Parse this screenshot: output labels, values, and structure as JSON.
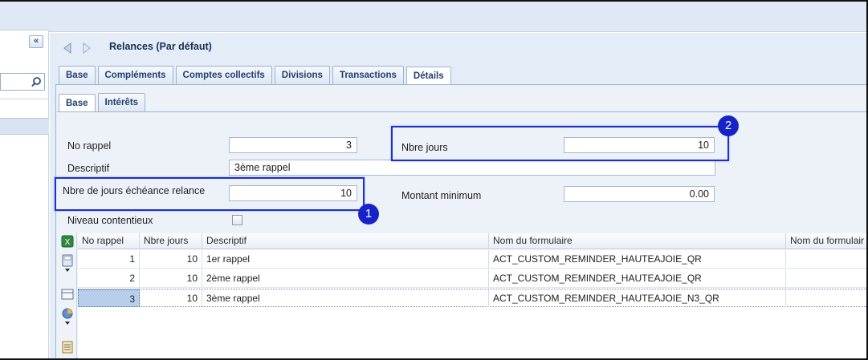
{
  "page": {
    "title": "Relances (Par défaut)"
  },
  "tabs": [
    "Base",
    "Compléments",
    "Comptes collectifs",
    "Divisions",
    "Transactions",
    "Détails"
  ],
  "active_tab": "Détails",
  "subtabs": [
    "Base",
    "Intérêts"
  ],
  "active_subtab": "Base",
  "form": {
    "no_rappel_label": "No rappel",
    "no_rappel_value": "3",
    "descriptif_label": "Descriptif",
    "descriptif_value": "3ème rappel",
    "nbre_jours_echeance_label": "Nbre de jours échéance relance",
    "nbre_jours_echeance_value": "10",
    "niveau_contentieux_label": "Niveau contentieux",
    "nbre_jours_label": "Nbre jours",
    "nbre_jours_value": "10",
    "montant_minimum_label": "Montant minimum",
    "montant_minimum_value": "0.00"
  },
  "callouts": [
    "1",
    "2"
  ],
  "grid": {
    "columns": [
      "No rappel",
      "Nbre jours",
      "Descriptif",
      "Nom du formulaire",
      "Nom du formulair"
    ],
    "rows": [
      {
        "no": "1",
        "jours": "10",
        "descriptif": "1er rappel",
        "formulaire": "ACT_CUSTOM_REMINDER_HAUTEAJOIE_QR"
      },
      {
        "no": "2",
        "jours": "10",
        "descriptif": "2ème rappel",
        "formulaire": "ACT_CUSTOM_REMINDER_HAUTEAJOIE_QR"
      },
      {
        "no": "3",
        "jours": "10",
        "descriptif": "3ème rappel",
        "formulaire": "ACT_CUSTOM_REMINDER_HAUTEAJOIE_N3_QR"
      }
    ]
  },
  "left": {
    "collapse_label": "«"
  },
  "colors": {
    "accent": "#1c2fd0",
    "badge": "#1523c8",
    "panel": "#edf2f9",
    "header_text": "#22406c"
  }
}
